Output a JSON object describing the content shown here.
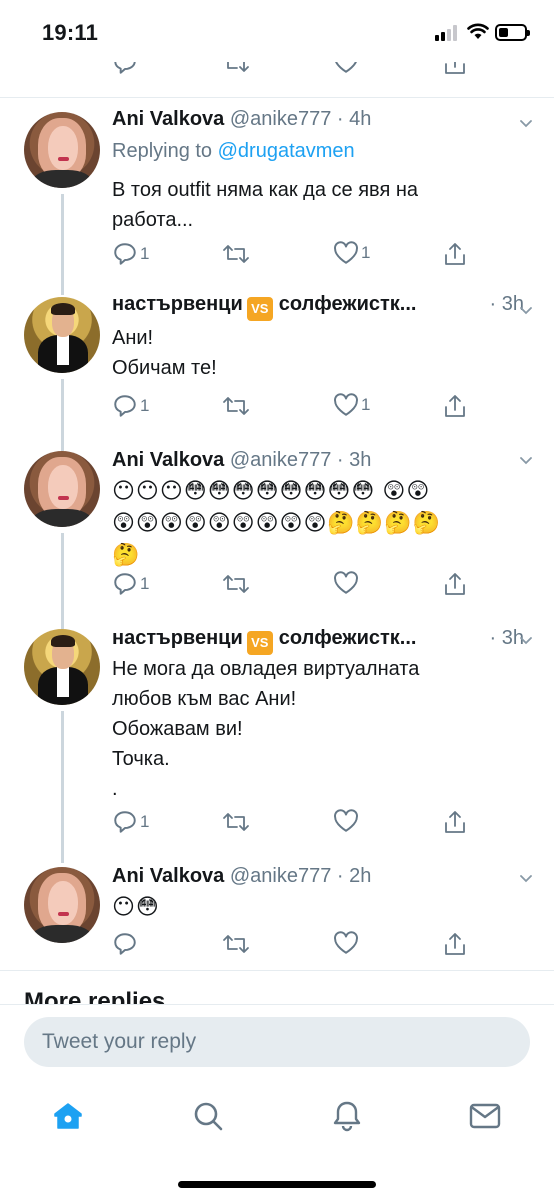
{
  "status_bar": {
    "time": "19:11"
  },
  "colors": {
    "accent": "#1da1f2",
    "secondary_text": "#657786",
    "vs_badge": "#f5a623"
  },
  "tweets": [
    {
      "author_name": "Ani Valkova",
      "author_handle": "@anike777",
      "time": "· 4h",
      "replying_label": "Replying to",
      "replying_to": "@drugatavmen",
      "text_lines": [
        "В тоя outfit няма как да се явя на",
        "работа..."
      ],
      "reply_count": "1",
      "like_count": "1"
    },
    {
      "author_name_left": "настървенци",
      "badge": "VS",
      "author_name_right": "солфежистк...",
      "time": "· 3h",
      "text_lines": [
        "Ани!",
        "Обичам те!"
      ],
      "reply_count": "1",
      "like_count": "1"
    },
    {
      "author_name": "Ani Valkova",
      "author_handle": "@anike777",
      "time": "· 3h",
      "emoji_lines": [
        "😶😶😶😳😳😳😳😳😳😳😳 😲😲",
        "😲😲😲😲😲😲😲😲😲🤔🤔🤔🤔",
        "🤔"
      ],
      "reply_count": "1",
      "like_count": ""
    },
    {
      "author_name_left": "настървенци",
      "badge": "VS",
      "author_name_right": "солфежистк...",
      "time": "· 3h",
      "text_lines": [
        "Не мога да овладея виртуалната",
        "любов към вас Ани!",
        "Обожавам ви!",
        "Точка.",
        "."
      ],
      "reply_count": "1",
      "like_count": ""
    },
    {
      "author_name": "Ani Valkova",
      "author_handle": "@anike777",
      "time": "· 2h",
      "emoji_lines": [
        "😶😳"
      ],
      "reply_count": "",
      "like_count": ""
    }
  ],
  "more_replies_label": "More replies",
  "reply_bar": {
    "placeholder": "Tweet your reply"
  },
  "tab_bar": {
    "icons": [
      "home-icon",
      "search-icon",
      "notifications-icon",
      "messages-icon"
    ]
  }
}
